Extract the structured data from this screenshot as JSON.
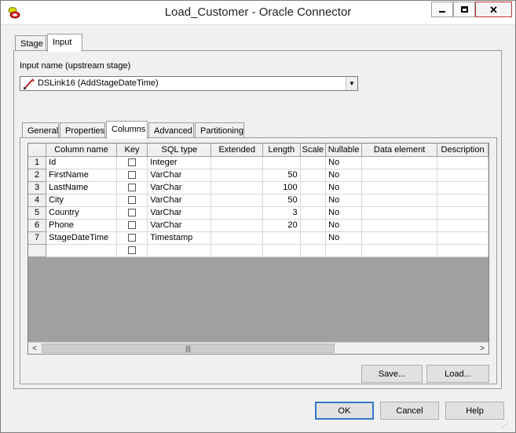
{
  "window": {
    "title": "Load_Customer - Oracle Connector"
  },
  "outer_tabs": [
    {
      "label": "Stage"
    },
    {
      "label": "Input"
    }
  ],
  "input": {
    "label": "Input name (upstream stage)",
    "selected": "DSLink16 (AddStageDateTime)"
  },
  "inner_tabs": [
    {
      "label": "General"
    },
    {
      "label": "Properties"
    },
    {
      "label": "Columns"
    },
    {
      "label": "Advanced"
    },
    {
      "label": "Partitioning"
    }
  ],
  "grid": {
    "headers": [
      "Column name",
      "Key",
      "SQL type",
      "Extended",
      "Length",
      "Scale",
      "Nullable",
      "Data element",
      "Description"
    ],
    "rows": [
      {
        "num": "1",
        "name": "Id",
        "sql_type": "Integer",
        "extended": "",
        "length": "",
        "scale": "",
        "nullable": "No"
      },
      {
        "num": "2",
        "name": "FirstName",
        "sql_type": "VarChar",
        "extended": "",
        "length": "50",
        "scale": "",
        "nullable": "No"
      },
      {
        "num": "3",
        "name": "LastName",
        "sql_type": "VarChar",
        "extended": "",
        "length": "100",
        "scale": "",
        "nullable": "No"
      },
      {
        "num": "4",
        "name": "City",
        "sql_type": "VarChar",
        "extended": "",
        "length": "50",
        "scale": "",
        "nullable": "No"
      },
      {
        "num": "5",
        "name": "Country",
        "sql_type": "VarChar",
        "extended": "",
        "length": "3",
        "scale": "",
        "nullable": "No"
      },
      {
        "num": "6",
        "name": "Phone",
        "sql_type": "VarChar",
        "extended": "",
        "length": "20",
        "scale": "",
        "nullable": "No"
      },
      {
        "num": "7",
        "name": "StageDateTime",
        "sql_type": "Timestamp",
        "extended": "",
        "length": "",
        "scale": "",
        "nullable": "No"
      }
    ]
  },
  "buttons": {
    "save": "Save...",
    "load": "Load...",
    "ok": "OK",
    "cancel": "Cancel",
    "help": "Help"
  },
  "icons": {
    "app": "oracle-connector-icon",
    "link": "link-icon"
  },
  "colors": {
    "default_button_border": "#2f78cc",
    "grid_empty_area": "#a0a0a0"
  }
}
